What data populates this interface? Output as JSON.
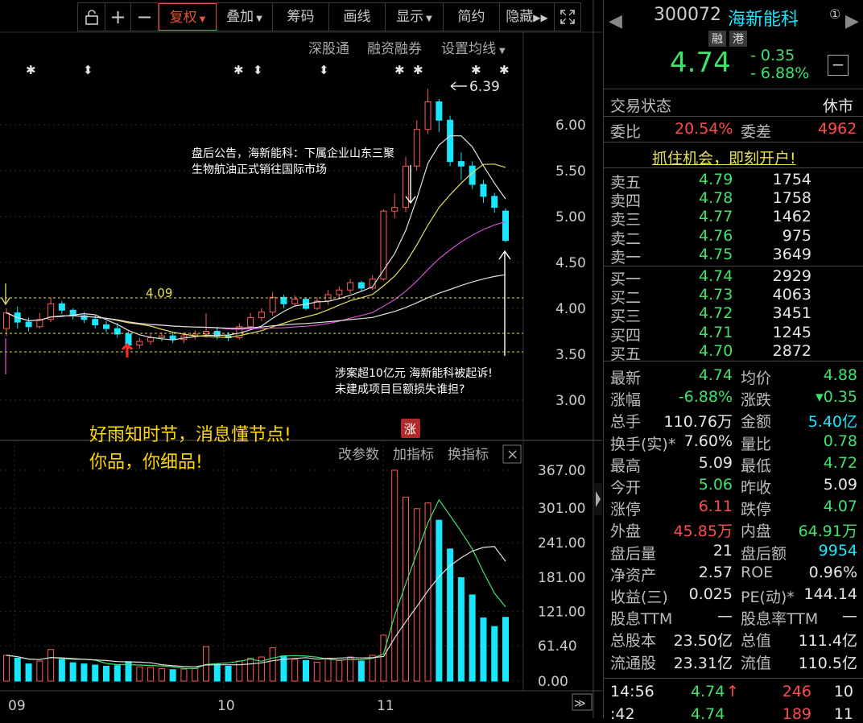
{
  "toolbar": {
    "lock_icon": "lock-icon",
    "plus": "+",
    "minus": "−",
    "fuquan": "复权",
    "diejia": "叠加",
    "chouma": "筹码",
    "huaxian": "画线",
    "xianshi": "显示",
    "jianyue": "简约",
    "yincang": "隐藏",
    "expand_icon": "expand-icon"
  },
  "submenu": {
    "shengutong": "深股通",
    "rongzi": "融资融券",
    "shezhi": "设置均线"
  },
  "kline": {
    "price_axis": [
      "6.00",
      "5.50",
      "5.00",
      "4.50",
      "4.00",
      "3.50",
      "3.00"
    ],
    "high_label": "6.39",
    "level_label": "4.09",
    "up_badge": "涨",
    "annotation1_line1": "盘后公告，海新能科：下属企业山东三聚",
    "annotation1_line2": "生物航油正式销往国际市场",
    "annotation2_line1": "涉案超10亿元 海新能科被起诉!",
    "annotation2_line2": "未建成项目巨额损失谁担?",
    "slogan1": "好雨知时节，消息懂节点!",
    "slogan2": "你品，你细品!"
  },
  "volume": {
    "gaicanshu": "改参数",
    "jiazhibiao": "加指标",
    "huanzhibiao": "换指标",
    "close": "×",
    "axis": [
      "367.00",
      "301.00",
      "241.00",
      "181.00",
      "121.00",
      "61.40",
      "0.00"
    ]
  },
  "date_axis": [
    "09",
    "10",
    "11"
  ],
  "chart_data": {
    "type": "candlestick",
    "price_range": [
      2.8,
      6.6
    ],
    "volume_range": [
      0,
      367
    ],
    "months": [
      "09",
      "10",
      "11"
    ],
    "candles": [
      {
        "o": 3.78,
        "c": 3.95,
        "h": 4.0,
        "l": 3.7,
        "v": 45
      },
      {
        "o": 3.95,
        "c": 3.85,
        "h": 4.02,
        "l": 3.78,
        "v": 40
      },
      {
        "o": 3.85,
        "c": 3.8,
        "h": 3.9,
        "l": 3.75,
        "v": 30
      },
      {
        "o": 3.8,
        "c": 3.88,
        "h": 3.95,
        "l": 3.78,
        "v": 35
      },
      {
        "o": 3.88,
        "c": 4.05,
        "h": 4.12,
        "l": 3.85,
        "v": 55
      },
      {
        "o": 4.05,
        "c": 3.98,
        "h": 4.08,
        "l": 3.94,
        "v": 38
      },
      {
        "o": 3.98,
        "c": 3.92,
        "h": 4.0,
        "l": 3.88,
        "v": 32
      },
      {
        "o": 3.92,
        "c": 3.88,
        "h": 3.96,
        "l": 3.84,
        "v": 30
      },
      {
        "o": 3.88,
        "c": 3.82,
        "h": 3.92,
        "l": 3.78,
        "v": 28
      },
      {
        "o": 3.82,
        "c": 3.78,
        "h": 3.86,
        "l": 3.74,
        "v": 26
      },
      {
        "o": 3.78,
        "c": 3.72,
        "h": 3.84,
        "l": 3.68,
        "v": 27
      },
      {
        "o": 3.72,
        "c": 3.6,
        "h": 3.75,
        "l": 3.56,
        "v": 34
      },
      {
        "o": 3.6,
        "c": 3.64,
        "h": 3.68,
        "l": 3.56,
        "v": 25
      },
      {
        "o": 3.64,
        "c": 3.68,
        "h": 3.72,
        "l": 3.6,
        "v": 24
      },
      {
        "o": 3.68,
        "c": 3.7,
        "h": 3.74,
        "l": 3.64,
        "v": 22
      },
      {
        "o": 3.7,
        "c": 3.66,
        "h": 3.74,
        "l": 3.62,
        "v": 20
      },
      {
        "o": 3.66,
        "c": 3.7,
        "h": 3.74,
        "l": 3.62,
        "v": 21
      },
      {
        "o": 3.7,
        "c": 3.72,
        "h": 3.76,
        "l": 3.66,
        "v": 22
      },
      {
        "o": 3.72,
        "c": 3.75,
        "h": 3.95,
        "l": 3.68,
        "v": 60
      },
      {
        "o": 3.75,
        "c": 3.7,
        "h": 3.8,
        "l": 3.66,
        "v": 30
      },
      {
        "o": 3.7,
        "c": 3.68,
        "h": 3.74,
        "l": 3.64,
        "v": 26
      },
      {
        "o": 3.68,
        "c": 3.8,
        "h": 3.84,
        "l": 3.66,
        "v": 35
      },
      {
        "o": 3.8,
        "c": 3.9,
        "h": 3.95,
        "l": 3.78,
        "v": 40
      },
      {
        "o": 3.9,
        "c": 3.96,
        "h": 4.0,
        "l": 3.86,
        "v": 42
      },
      {
        "o": 3.96,
        "c": 4.12,
        "h": 4.18,
        "l": 3.92,
        "v": 58
      },
      {
        "o": 4.12,
        "c": 4.05,
        "h": 4.15,
        "l": 4.0,
        "v": 44
      },
      {
        "o": 4.05,
        "c": 4.1,
        "h": 4.14,
        "l": 4.02,
        "v": 38
      },
      {
        "o": 4.1,
        "c": 4.0,
        "h": 4.12,
        "l": 3.98,
        "v": 36
      },
      {
        "o": 4.0,
        "c": 4.08,
        "h": 4.12,
        "l": 3.98,
        "v": 33
      },
      {
        "o": 4.08,
        "c": 4.15,
        "h": 4.2,
        "l": 4.04,
        "v": 40
      },
      {
        "o": 4.15,
        "c": 4.2,
        "h": 4.24,
        "l": 4.1,
        "v": 36
      },
      {
        "o": 4.2,
        "c": 4.28,
        "h": 4.32,
        "l": 4.16,
        "v": 42
      },
      {
        "o": 4.28,
        "c": 4.22,
        "h": 4.3,
        "l": 4.18,
        "v": 35
      },
      {
        "o": 4.22,
        "c": 4.32,
        "h": 4.36,
        "l": 4.2,
        "v": 45
      },
      {
        "o": 4.32,
        "c": 5.06,
        "h": 5.08,
        "l": 4.3,
        "v": 80
      },
      {
        "o": 5.06,
        "c": 5.1,
        "h": 5.25,
        "l": 4.98,
        "v": 367
      },
      {
        "o": 5.1,
        "c": 5.55,
        "h": 5.65,
        "l": 5.05,
        "v": 320
      },
      {
        "o": 5.55,
        "c": 5.95,
        "h": 6.05,
        "l": 5.5,
        "v": 300
      },
      {
        "o": 5.95,
        "c": 6.25,
        "h": 6.39,
        "l": 5.9,
        "v": 310
      },
      {
        "o": 6.25,
        "c": 6.05,
        "h": 6.28,
        "l": 5.92,
        "v": 280
      },
      {
        "o": 6.05,
        "c": 5.6,
        "h": 6.1,
        "l": 5.55,
        "v": 230
      },
      {
        "o": 5.6,
        "c": 5.55,
        "h": 5.7,
        "l": 5.4,
        "v": 180
      },
      {
        "o": 5.55,
        "c": 5.35,
        "h": 5.6,
        "l": 5.3,
        "v": 150
      },
      {
        "o": 5.35,
        "c": 5.22,
        "h": 5.4,
        "l": 5.15,
        "v": 110
      },
      {
        "o": 5.22,
        "c": 5.1,
        "h": 5.26,
        "l": 5.04,
        "v": 95
      },
      {
        "o": 5.06,
        "c": 4.74,
        "h": 5.09,
        "l": 4.72,
        "v": 111
      }
    ]
  },
  "quote": {
    "code": "300072",
    "name": "海新能科",
    "badge_rong": "融",
    "badge_gang": "港",
    "price": "4.74",
    "change": "- 0.35",
    "change_pct": "- 6.88%",
    "minus_btn": "−",
    "circled_one": "①",
    "trade_state_label": "交易状态",
    "trade_state": "休市",
    "weibi_label": "委比",
    "weibi": "20.54%",
    "weicha_label": "委差",
    "weicha": "4962",
    "promo": "抓住机会，即刻开户!",
    "asks": [
      {
        "label": "卖五",
        "price": "4.79",
        "vol": "1754"
      },
      {
        "label": "卖四",
        "price": "4.78",
        "vol": "1758"
      },
      {
        "label": "卖三",
        "price": "4.77",
        "vol": "1462"
      },
      {
        "label": "卖二",
        "price": "4.76",
        "vol": "975"
      },
      {
        "label": "卖一",
        "price": "4.75",
        "vol": "3649"
      }
    ],
    "bids": [
      {
        "label": "买一",
        "price": "4.74",
        "vol": "2929"
      },
      {
        "label": "买二",
        "price": "4.73",
        "vol": "4063"
      },
      {
        "label": "买三",
        "price": "4.72",
        "vol": "3451"
      },
      {
        "label": "买四",
        "price": "4.71",
        "vol": "1245"
      },
      {
        "label": "买五",
        "price": "4.70",
        "vol": "2872"
      }
    ],
    "stats": [
      {
        "l1": "最新",
        "v1": "4.74",
        "c1": "green",
        "l2": "均价",
        "v2": "4.88",
        "c2": "green"
      },
      {
        "l1": "涨幅",
        "v1": "-6.88%",
        "c1": "green",
        "l2": "涨跌",
        "v2": "▾0.35",
        "c2": "green"
      },
      {
        "l1": "总手",
        "v1": "110.76万",
        "c1": "white",
        "l2": "金额",
        "v2": "5.40亿",
        "c2": "cyan"
      },
      {
        "l1": "换手(实)*",
        "v1": "7.60%",
        "c1": "white",
        "l2": "量比",
        "v2": "0.78",
        "c2": "green"
      },
      {
        "l1": "最高",
        "v1": "5.09",
        "c1": "white",
        "l2": "最低",
        "v2": "4.72",
        "c2": "green"
      },
      {
        "l1": "今开",
        "v1": "5.06",
        "c1": "green",
        "l2": "昨收",
        "v2": "5.09",
        "c2": "white"
      },
      {
        "l1": "涨停",
        "v1": "6.11",
        "c1": "red",
        "l2": "跌停",
        "v2": "4.07",
        "c2": "green"
      },
      {
        "l1": "外盘",
        "v1": "45.85万",
        "c1": "red",
        "l2": "内盘",
        "v2": "64.91万",
        "c2": "green"
      },
      {
        "l1": "盘后量",
        "v1": "21",
        "c1": "white",
        "l2": "盘后额",
        "v2": "9954",
        "c2": "cyan"
      },
      {
        "l1": "净资产",
        "v1": "2.57",
        "c1": "white",
        "l2": "ROE",
        "v2": "0.96%",
        "c2": "white"
      },
      {
        "l1": "收益(三)",
        "v1": "0.025",
        "c1": "white",
        "l2": "PE(动)*",
        "v2": "144.14",
        "c2": "white"
      },
      {
        "l1": "股息TTM",
        "v1": "—",
        "c1": "white",
        "l2": "股息率TTM",
        "v2": "—",
        "c2": "white"
      },
      {
        "l1": "总股本",
        "v1": "23.50亿",
        "c1": "white",
        "l2": "总值",
        "v2": "111.4亿",
        "c2": "white"
      },
      {
        "l1": "流通股",
        "v1": "23.31亿",
        "c1": "white",
        "l2": "流值",
        "v2": "110.5亿",
        "c2": "white"
      }
    ],
    "ticks": [
      {
        "time": "14:56",
        "price": "4.74",
        "arrow": "↑",
        "vol": "246",
        "n": "10"
      },
      {
        "time": ":42",
        "price": "4.74",
        "arrow": "",
        "vol": "189",
        "n": "11"
      }
    ]
  },
  "colors": {
    "up": "#ff5a5a",
    "down": "#19e6ff",
    "ma5": "#e0e0e0",
    "ma10": "#e6e05a",
    "ma20": "#d050d0",
    "ma60": "#e0e0e0"
  }
}
